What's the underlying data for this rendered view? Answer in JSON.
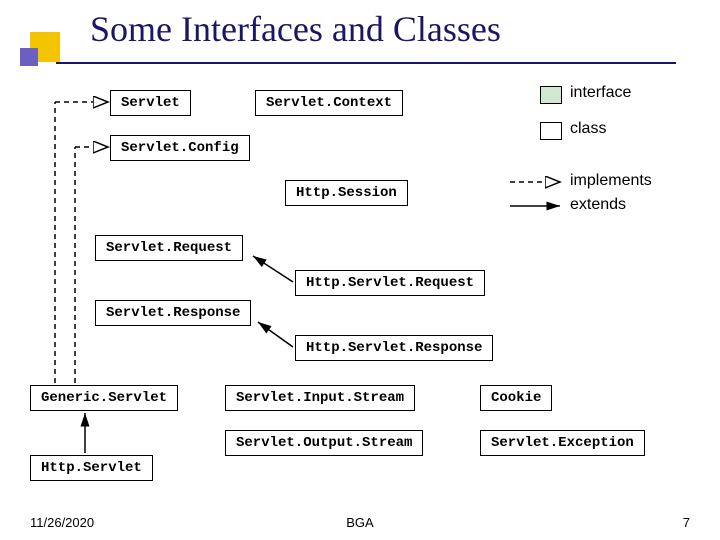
{
  "title": "Some Interfaces and Classes",
  "boxes": {
    "servlet": "Servlet",
    "servletContext": "Servlet.Context",
    "servletConfig": "Servlet.Config",
    "httpSession": "Http.Session",
    "servletRequest": "Servlet.Request",
    "httpServletRequest": "Http.Servlet.Request",
    "servletResponse": "Servlet.Response",
    "httpServletResponse": "Http.Servlet.Response",
    "genericServlet": "Generic.Servlet",
    "servletInputStream": "Servlet.Input.Stream",
    "cookie": "Cookie",
    "servletOutputStream": "Servlet.Output.Stream",
    "servletException": "Servlet.Exception",
    "httpServlet": "Http.Servlet"
  },
  "legend": {
    "interface": "interface",
    "class": "class",
    "implements": "implements",
    "extends": "extends"
  },
  "footer": {
    "date": "11/26/2020",
    "center": "BGA",
    "page": "7"
  }
}
